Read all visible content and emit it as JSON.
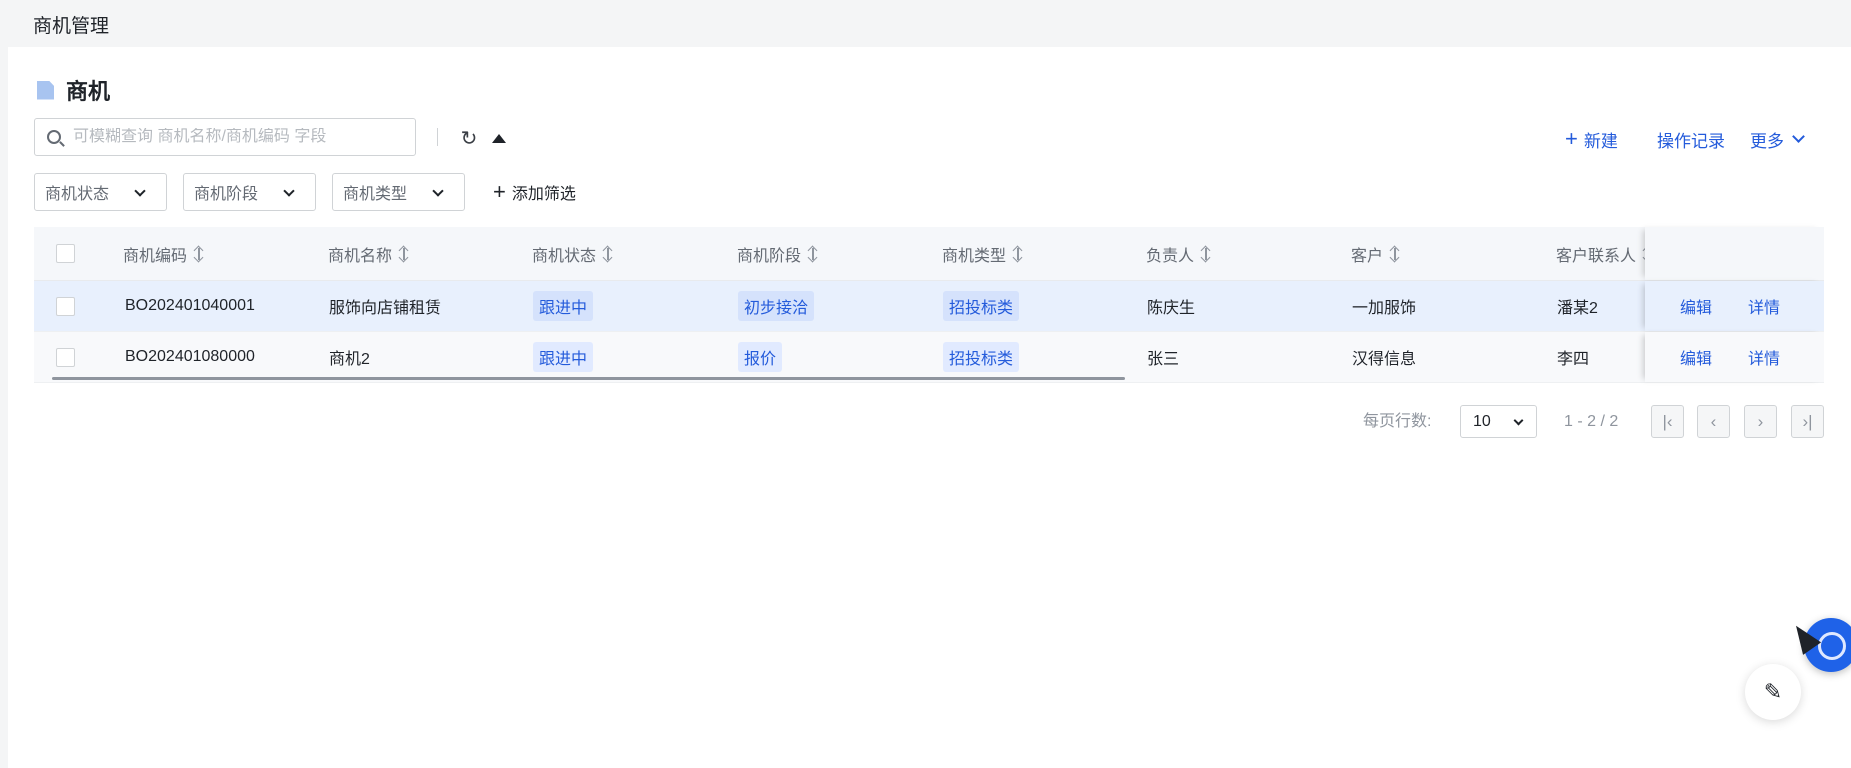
{
  "topbar": {
    "title": "商机管理"
  },
  "page": {
    "title": "商机"
  },
  "search": {
    "placeholder": "可模糊查询 商机名称/商机编码 字段"
  },
  "toolbar": {
    "new_label": "新建",
    "log_label": "操作记录",
    "more_label": "更多"
  },
  "filters": [
    {
      "label": "商机状态"
    },
    {
      "label": "商机阶段"
    },
    {
      "label": "商机类型"
    }
  ],
  "add_filter_label": "添加筛选",
  "table": {
    "columns": [
      "商机编码",
      "商机名称",
      "商机状态",
      "商机阶段",
      "商机类型",
      "负责人",
      "客户",
      "客户联系人"
    ],
    "rows": [
      {
        "code": "BO202401040001",
        "name": "服饰向店铺租赁",
        "status": "跟进中",
        "stage": "初步接洽",
        "type": "招投标类",
        "owner": "陈庆生",
        "customer": "一加服饰",
        "contact": "潘某2",
        "edit": "编辑",
        "detail": "详情"
      },
      {
        "code": "BO202401080000",
        "name": "商机2",
        "status": "跟进中",
        "stage": "报价",
        "type": "招投标类",
        "owner": "张三",
        "customer": "汉得信息",
        "contact": "李四",
        "edit": "编辑",
        "detail": "详情"
      }
    ]
  },
  "pagination": {
    "rows_per_page_label": "每页行数:",
    "page_size": "10",
    "range": "1 - 2 / 2"
  },
  "icons": [
    "search-icon",
    "refresh-icon",
    "caret-up-icon",
    "plus-icon",
    "chevron-down-icon",
    "document-icon",
    "sort-icon",
    "first-page-icon",
    "prev-page-icon",
    "next-page-icon",
    "last-page-icon",
    "assistant-icon",
    "note-edit-icon"
  ],
  "colors": {
    "accent": "#245bdb",
    "selected_row": "#e8f0fd",
    "tag_bg": "#e1eaff"
  }
}
